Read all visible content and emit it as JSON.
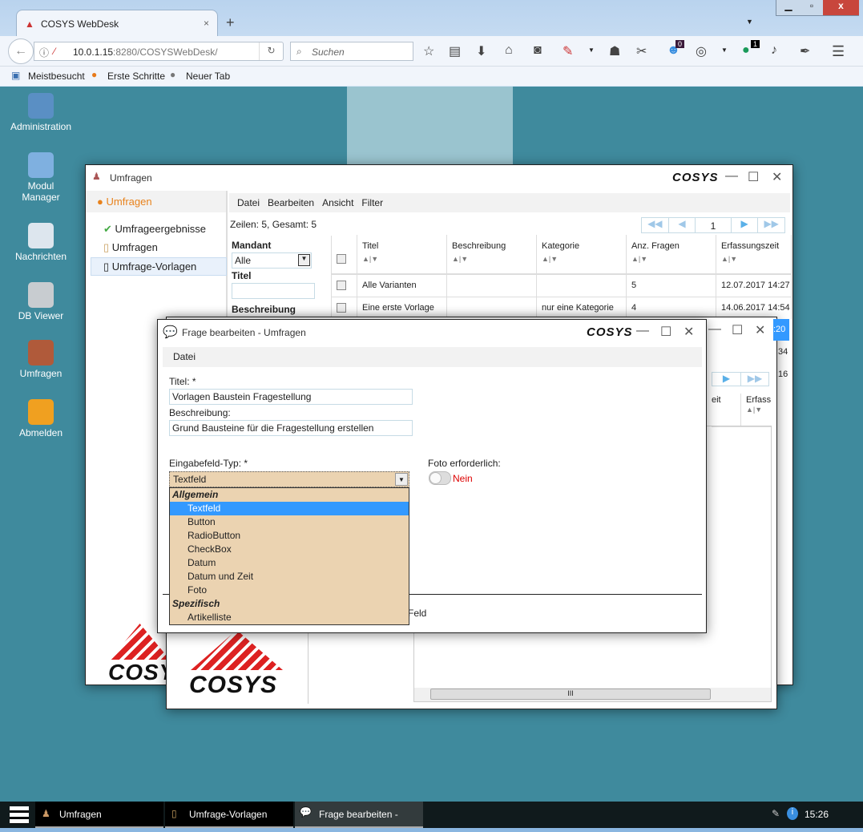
{
  "browser": {
    "tab_title": "COSYS WebDesk",
    "url_host": "10.0.1.15",
    "url_rest": ":8280/COSYSWebDesk/",
    "search_placeholder": "Suchen",
    "badge_pocket": "0",
    "badge_ext": "1",
    "bookmarks": [
      "Meistbesucht",
      "Erste Schritte",
      "Neuer Tab"
    ]
  },
  "desktop": {
    "icons": [
      {
        "label": "Administration",
        "color": "#5a8fc4"
      },
      {
        "label": "Modul Manager",
        "color": "#7fb0e0"
      },
      {
        "label": "Nachrichten",
        "color": "#dde6ee"
      },
      {
        "label": "DB Viewer",
        "color": "#c8ccd0"
      },
      {
        "label": "Umfragen",
        "color": "#b05a3a"
      },
      {
        "label": "Abmelden",
        "color": "#f0a020"
      }
    ]
  },
  "umfragen_window": {
    "title": "Umfragen",
    "logo": "COSYS",
    "nav_header": "Umfragen",
    "nav_items": [
      "Umfrageergebnisse",
      "Umfragen",
      "Umfrage-Vorlagen"
    ],
    "menu": [
      "Datei",
      "Bearbeiten",
      "Ansicht",
      "Filter"
    ],
    "rows_info": "Zeilen: 5, Gesamt: 5",
    "page": "1",
    "filter": {
      "mandant_label": "Mandant",
      "mandant_value": "Alle",
      "titel_label": "Titel",
      "beschreibung_label": "Beschreibung"
    },
    "columns": [
      "Titel",
      "Beschreibung",
      "Kategorie",
      "Anz. Fragen",
      "Erfassungszeit"
    ],
    "rows": [
      [
        "Alle Varianten",
        "",
        "",
        "5",
        "12.07.2017 14:27"
      ],
      [
        "Eine erste Vorlage",
        "",
        "nur eine Kategorie",
        "4",
        "14.06.2017 14:54"
      ]
    ],
    "partial_times": [
      ":20",
      ":34",
      ":16"
    ]
  },
  "vorlagen_window": {
    "col_partial_1": "eit",
    "col_partial_2": "Erfass",
    "logo": "COSYS"
  },
  "dialog": {
    "title": "Frage bearbeiten - Umfragen",
    "logo": "COSYS",
    "menu": "Datei",
    "titel_label": "Titel: *",
    "titel_value": "Vorlagen Baustein Fragestellung",
    "beschreibung_label": "Beschreibung:",
    "beschreibung_value": "Grund Bausteine für die Fragestellung erstellen",
    "typ_label": "Eingabefeld-Typ: *",
    "typ_value": "Textfeld",
    "foto_label": "Foto erforderlich:",
    "foto_value": "Nein",
    "foto_on": false,
    "below_text": "Feld",
    "options": [
      {
        "group": "Allgemein"
      },
      {
        "label": "Textfeld",
        "selected": true
      },
      {
        "label": "Button"
      },
      {
        "label": "RadioButton"
      },
      {
        "label": "CheckBox"
      },
      {
        "label": "Datum"
      },
      {
        "label": "Datum und Zeit"
      },
      {
        "label": "Foto"
      },
      {
        "group": "Spezifisch"
      },
      {
        "label": "Artikelliste"
      }
    ]
  },
  "taskbar": {
    "items": [
      "Umfragen",
      "Umfrage-Vorlagen",
      "Frage bearbeiten -"
    ],
    "clock": "15:26"
  },
  "colors": {
    "desktop": "#3f8a9d",
    "selection": "#3399ff",
    "dropdown_bg": "#ebd3b1",
    "accent_orange": "#e8821c",
    "nein_red": "#dd0000"
  }
}
